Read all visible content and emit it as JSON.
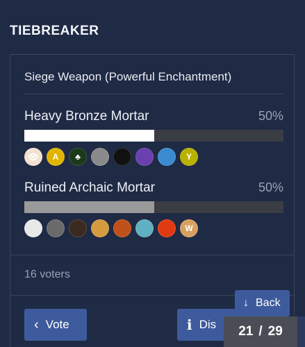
{
  "header": {
    "title": "TIEBREAKER"
  },
  "poll": {
    "question": "Siege Weapon (Powerful Enchantment)",
    "options": [
      {
        "label": "Heavy Bronze Mortar",
        "percent_text": "50%",
        "percent": 50,
        "avatars": [
          {
            "icon": "eye-avatar",
            "text": "👁"
          },
          {
            "icon": "letter-avatar",
            "text": "A"
          },
          {
            "icon": "green-avatar",
            "text": "♣"
          },
          {
            "icon": "grey-avatar",
            "text": ""
          },
          {
            "icon": "dark-avatar",
            "text": ""
          },
          {
            "icon": "purple-avatar",
            "text": ""
          },
          {
            "icon": "blue-avatar",
            "text": ""
          },
          {
            "icon": "letter-avatar",
            "text": "Y"
          }
        ]
      },
      {
        "label": "Ruined Archaic Mortar",
        "percent_text": "50%",
        "percent": 50,
        "avatars": [
          {
            "icon": "face-avatar",
            "text": ""
          },
          {
            "icon": "grey-avatar",
            "text": ""
          },
          {
            "icon": "character-avatar",
            "text": ""
          },
          {
            "icon": "food-avatar",
            "text": ""
          },
          {
            "icon": "face-avatar",
            "text": ""
          },
          {
            "icon": "anime-avatar",
            "text": ""
          },
          {
            "icon": "sun-avatar",
            "text": ""
          },
          {
            "icon": "letter-avatar",
            "text": "W"
          }
        ]
      }
    ],
    "voters_text": "16  voters"
  },
  "actions": {
    "vote_label": "Vote",
    "discourse_label": "Dis",
    "back_label": "Back"
  },
  "pager": {
    "current": "21",
    "separator": "/",
    "total": "29"
  },
  "colors": {
    "background": "#1f2a44",
    "button": "#3d5b9c",
    "bar_track": "#3a3d44",
    "bar_fill_1": "#ffffff",
    "bar_fill_2": "#9a9a9a"
  }
}
